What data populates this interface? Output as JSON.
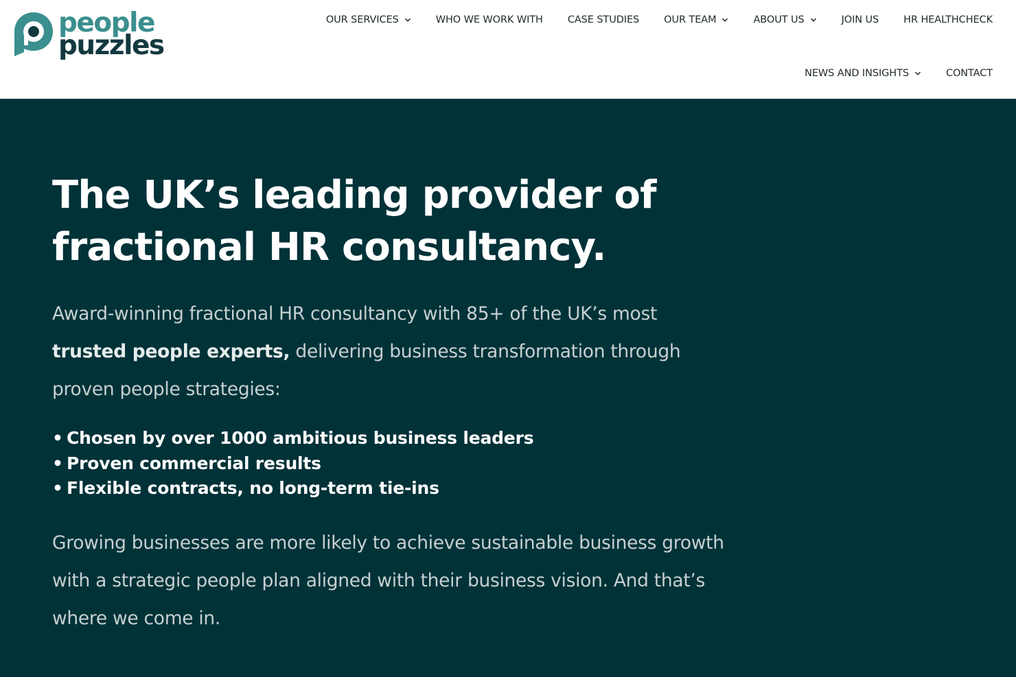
{
  "brand": {
    "name_line_1": "people",
    "name_line_2": "puzzles",
    "colors": {
      "teal": "#3b8f8e",
      "dark": "#13393f"
    }
  },
  "nav": {
    "row_1": [
      {
        "label": "OUR SERVICES",
        "has_dropdown": true
      },
      {
        "label": "WHO WE WORK WITH",
        "has_dropdown": false
      },
      {
        "label": "CASE STUDIES",
        "has_dropdown": false
      },
      {
        "label": "OUR TEAM",
        "has_dropdown": true
      },
      {
        "label": "ABOUT US",
        "has_dropdown": true
      },
      {
        "label": "JOIN US",
        "has_dropdown": false
      },
      {
        "label": "HR HEALTHCHECK",
        "has_dropdown": false
      }
    ],
    "row_2": [
      {
        "label": "NEWS AND INSIGHTS",
        "has_dropdown": true
      },
      {
        "label": "CONTACT",
        "has_dropdown": false
      }
    ]
  },
  "hero": {
    "background_color": "#003238",
    "heading_line_1": "The UK’s leading provider of",
    "heading_line_2": "fractional HR consultancy.",
    "intro_before": "Award-winning fractional HR consultancy with 85+ of the UK’s most ",
    "intro_bold": "trusted people experts,",
    "intro_after": " delivering business transformation through proven people strategies:",
    "bullet_char": "•",
    "bullets": [
      "Chosen by over 1000 ambitious business leaders",
      "Proven commercial results",
      "Flexible contracts, no long-term tie-ins"
    ],
    "outro": "Growing businesses are more likely to achieve sustainable business growth with a strategic people plan aligned with their business vision. And that’s where we come in."
  }
}
